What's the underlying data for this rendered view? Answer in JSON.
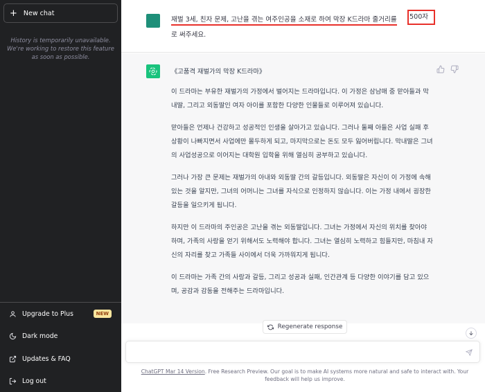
{
  "sidebar": {
    "new_chat_label": "New chat",
    "history_note": "History is temporarily unavailable. We're working to restore this feature as soon as possible.",
    "items": [
      {
        "label": "Upgrade to Plus",
        "icon": "user-icon",
        "badge": "NEW"
      },
      {
        "label": "Dark mode",
        "icon": "moon-icon"
      },
      {
        "label": "Updates & FAQ",
        "icon": "external-link-icon"
      },
      {
        "label": "Log out",
        "icon": "logout-icon"
      }
    ]
  },
  "conversation": {
    "user_message": {
      "underlined_text": "재벌 3세, 친자 문제, 고난을 겪는 여주인공을 소재로 하여 막장 K드라마 줄거리를",
      "boxed_text": "500자",
      "line2": "로 써주세요."
    },
    "assistant_message": {
      "title": "《고품격 재벌가의 막장 K드라마》",
      "paragraphs": [
        "이 드라마는 부유한 재벌가의 가정에서 벌어지는 드라마입니다. 이 가정은 삼남매 중 맏아들과 막내딸, 그리고 외동딸인 여자 아이를 포함한 다양한 인물들로 이루어져 있습니다.",
        "맏아들은 언제나 건강하고 성공적인 인생을 살아가고 있습니다. 그러나 둘째 아들은 사업 실패 후 상황이 나빠지면서 사업에만 몰두하게 되고, 마지막으로는 돈도 모두 잃어버립니다. 막내딸은 그녀의 사업성공으로 이어지는 대학원 입학을 위해 열심히 공부하고 있습니다.",
        "그러나 가장 큰 문제는 재벌가의 아내와 외동딸 간의 갈등입니다. 외동딸은 자신이 이 가정에 속해있는 것을 알지만, 그녀의 어머니는 그녀를 자식으로 인정하지 않습니다. 이는 가정 내에서 굉장한 갈등을 일으키게 됩니다.",
        "하지만 이 드라마의 주인공은 고난을 겪는 외동딸입니다. 그녀는 가정에서 자신의 위치를 찾아야 하며, 가족의 사랑을 얻기 위해서도 노력해야 합니다. 그녀는 열심히 노력하고 힘들지만, 마침내 자신의 자리를 찾고 가족들 사이에서 더욱 가까워지게 됩니다.",
        "이 드라마는 가족 간의 사랑과 갈등, 그리고 성공과 실패, 인간관계 등 다양한 이야기를 담고 있으며, 공감과 감동을 전해주는 드라마입니다."
      ]
    }
  },
  "controls": {
    "regenerate_label": "Regenerate response",
    "input_value": "",
    "input_placeholder": ""
  },
  "footer": {
    "version_link": "ChatGPT Mar 14 Version",
    "text": ". Free Research Preview. Our goal is to make AI systems more natural and safe to interact with. Your feedback will help us improve."
  },
  "colors": {
    "sidebar_bg": "#202123",
    "user_avatar": "#1e8f79",
    "bot_avatar": "#19c37d",
    "highlight_red": "#e8302a",
    "new_badge_bg": "#fae69e"
  }
}
